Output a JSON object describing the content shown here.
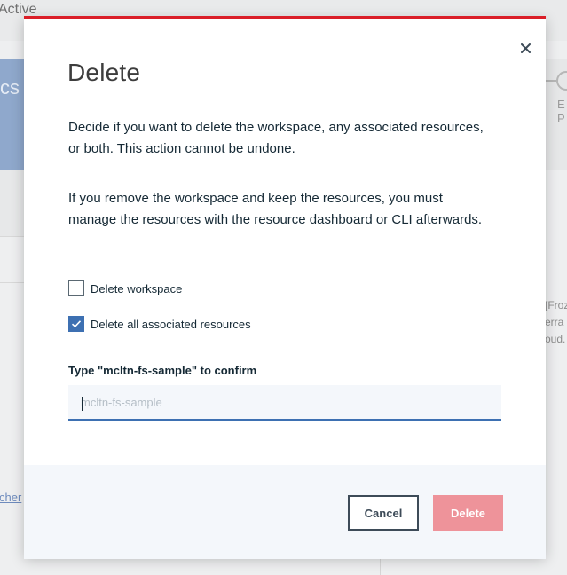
{
  "background": {
    "status_text": "Active",
    "card_text": "cs",
    "link_text": "cher",
    "right_step_1": "E",
    "right_step_2": "P",
    "right_snippet_1": "[Froz",
    "right_snippet_2": "erra",
    "right_snippet_3": "oud."
  },
  "modal": {
    "title": "Delete",
    "close_icon": "close-icon",
    "paragraph_1": "Decide if you want to delete the workspace, any associated resources, or both. This action cannot be undone.",
    "paragraph_2": "If you remove the workspace and keep the resources, you must manage the resources with the resource dashboard or CLI afterwards.",
    "checkboxes": [
      {
        "label": "Delete workspace",
        "checked": false
      },
      {
        "label": "Delete all associated resources",
        "checked": true
      }
    ],
    "confirm_label": "Type \"mcltn-fs-sample\" to confirm",
    "confirm_input": {
      "value": "",
      "placeholder": "mcltn-fs-sample"
    },
    "buttons": {
      "cancel": "Cancel",
      "delete": "Delete"
    }
  },
  "colors": {
    "danger": "#da1e28",
    "delete_disabled": "#ee939a",
    "primary_blue": "#3d70b2",
    "text": "#152935"
  }
}
